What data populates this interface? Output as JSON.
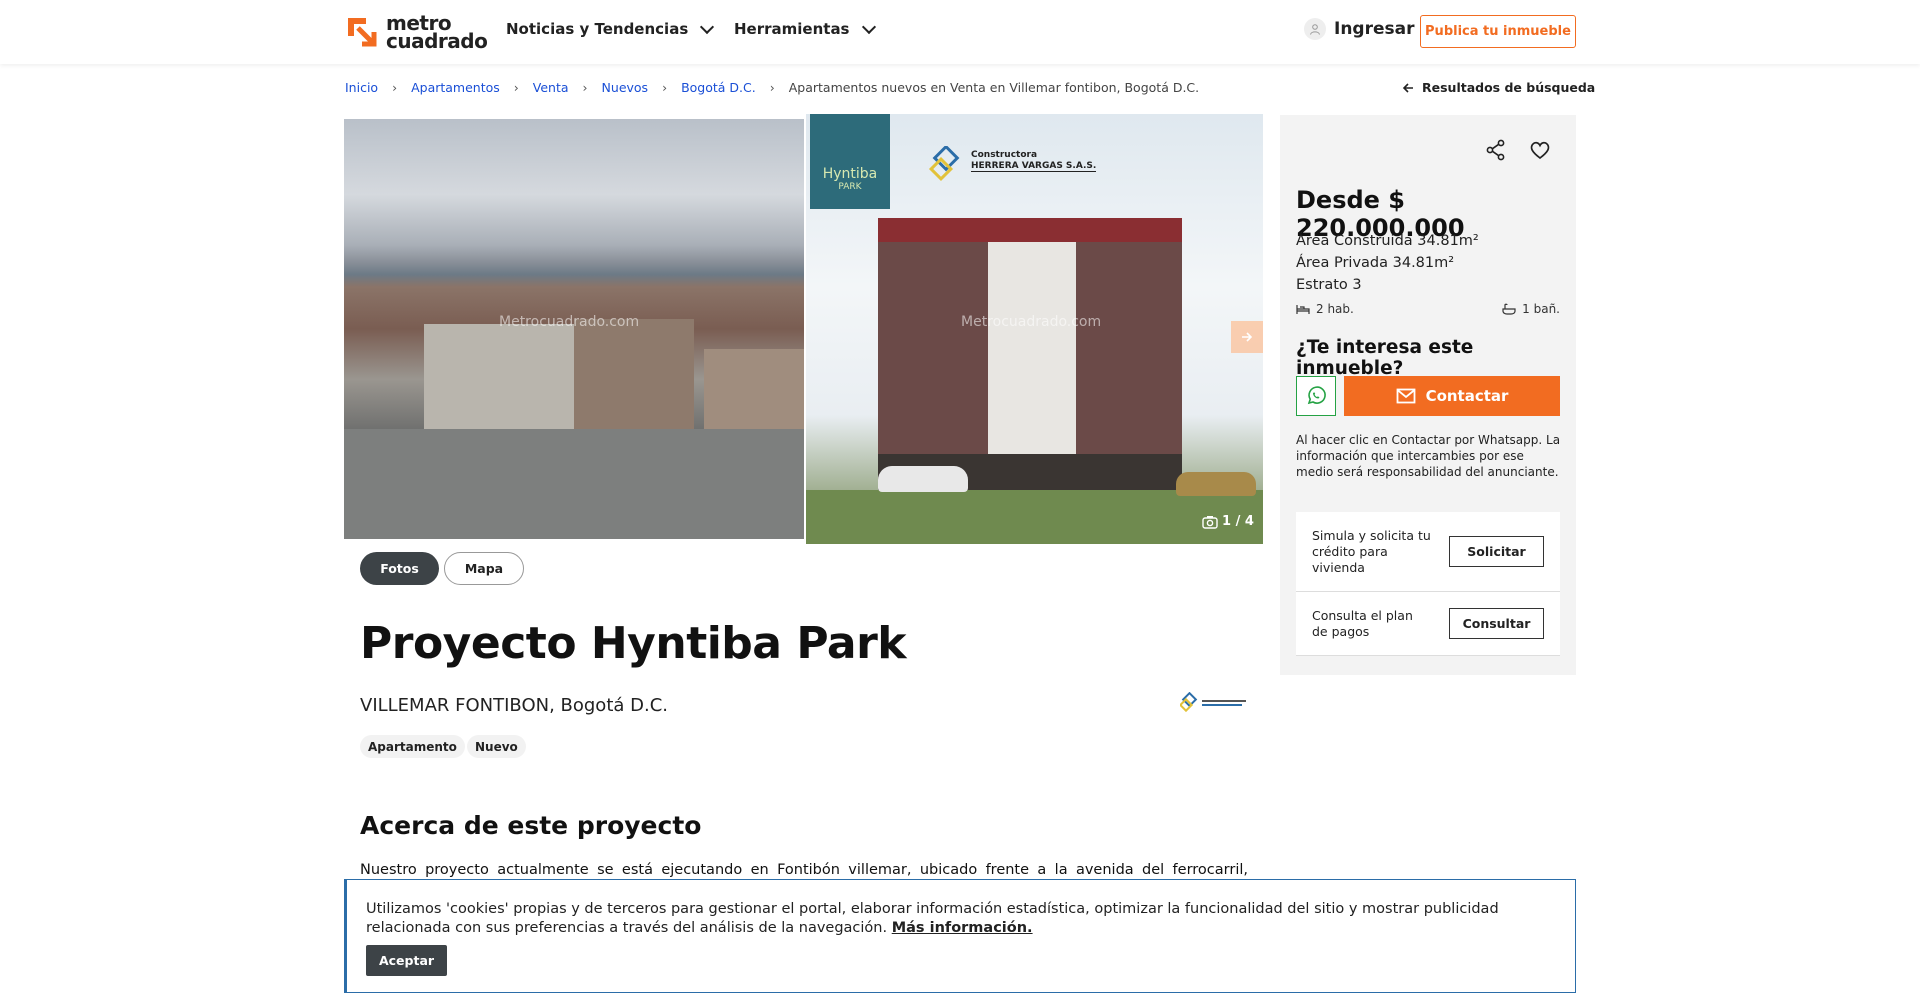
{
  "header": {
    "logo_line1": "metro",
    "logo_line2": "cuadrado",
    "nav": [
      {
        "label": "Noticias y Tendencias"
      },
      {
        "label": "Herramientas"
      }
    ],
    "login_label": "Ingresar",
    "publish_label": "Publica tu inmueble"
  },
  "breadcrumb": {
    "items": [
      "Inicio",
      "Apartamentos",
      "Venta",
      "Nuevos",
      "Bogotá D.C."
    ],
    "current": "Apartamentos nuevos en Venta en Villemar fontibon, Bogotá D.C.",
    "back_label": "Resultados de búsqueda"
  },
  "gallery": {
    "watermark": "Metrocuadrado.com",
    "photo_counter": "1 / 4",
    "project_sign_top": "Hyntiba",
    "project_sign_bottom": "PARK",
    "builder_line1": "Constructora",
    "builder_line2": "HERRERA VARGAS S.A.S."
  },
  "tabs": {
    "photos": "Fotos",
    "map": "Mapa"
  },
  "listing": {
    "title": "Proyecto Hyntiba Park",
    "location": "VILLEMAR FONTIBON, Bogotá D.C.",
    "tags": [
      "Apartamento",
      "Nuevo"
    ]
  },
  "about": {
    "heading": "Acerca de este proyecto",
    "text": "Nuestro proyecto actualmente se está ejecutando en Fontibón villemar, ubicado frente a la avenida del ferrocarril, ubicado"
  },
  "sidebar": {
    "price": "Desde $ 220.000.000",
    "built_area": "Área Construida 34.81m²",
    "private_area": "Área Privada 34.81m²",
    "strata": "Estrato 3",
    "bedrooms": "2 hab.",
    "bathrooms": "1 bañ.",
    "interest_heading": "¿Te interesa este inmueble?",
    "contact_label": "Contactar",
    "disclaimer": "Al hacer clic en Contactar por Whatsapp. La información que intercambies por ese medio será responsabilidad del anunciante.",
    "credit_text": "Simula y solicita tu crédito para vivienda",
    "credit_button": "Solicitar",
    "payment_text": "Consulta el plan de pagos",
    "payment_button": "Consultar"
  },
  "cookies": {
    "text": "Utilizamos 'cookies' propias y de terceros para gestionar el portal, elaborar información estadística, optimizar la funcionalidad del sitio y mostrar publicidad relacionada con sus preferencias a través del análisis de la navegación.",
    "more_link": "Más información.",
    "accept_label": "Aceptar"
  },
  "colors": {
    "accent": "#f26c21",
    "link": "#1a4fd6",
    "whatsapp": "#25a244",
    "dark_button": "#3d4347"
  }
}
